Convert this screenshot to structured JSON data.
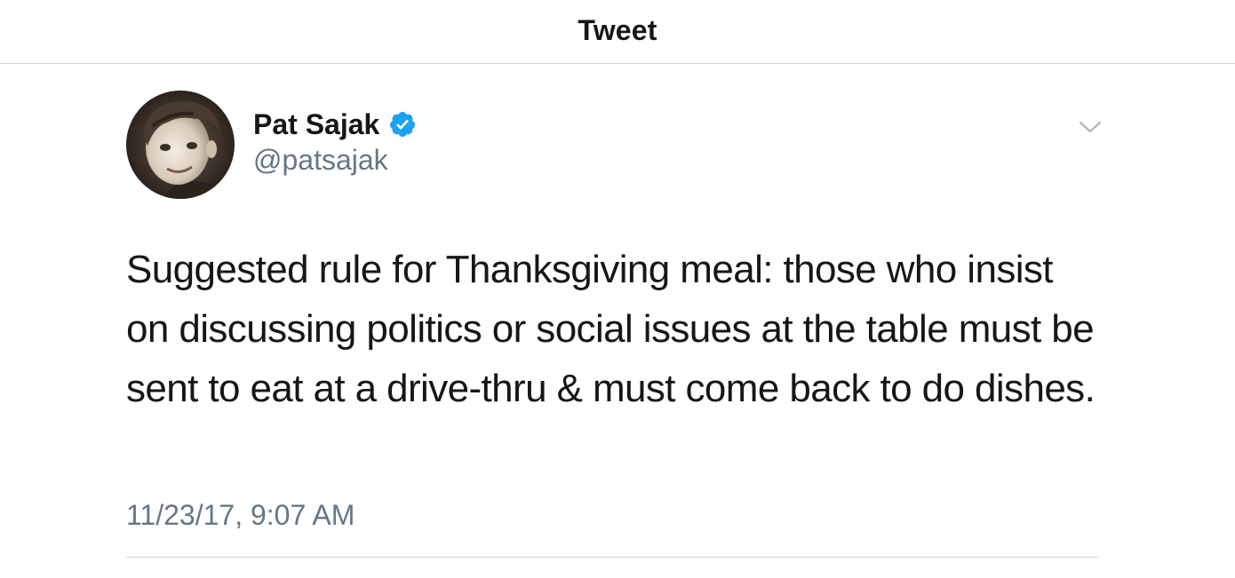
{
  "header": {
    "title": "Tweet"
  },
  "author": {
    "display_name": "Pat Sajak",
    "handle": "@patsajak",
    "verified": true,
    "badge_color": "#1da1f2"
  },
  "tweet": {
    "text": "Suggested rule for Thanksgiving meal: those who insist on discussing politics or social issues at the table must be sent to eat at a drive-thru & must come back to do dishes.",
    "timestamp": "11/23/17, 9:07 AM"
  },
  "icons": {
    "verified": "verified-badge-icon",
    "more": "chevron-down-icon"
  },
  "colors": {
    "text": "#14171a",
    "secondary_text": "#657786",
    "divider": "#d3d6d9"
  }
}
